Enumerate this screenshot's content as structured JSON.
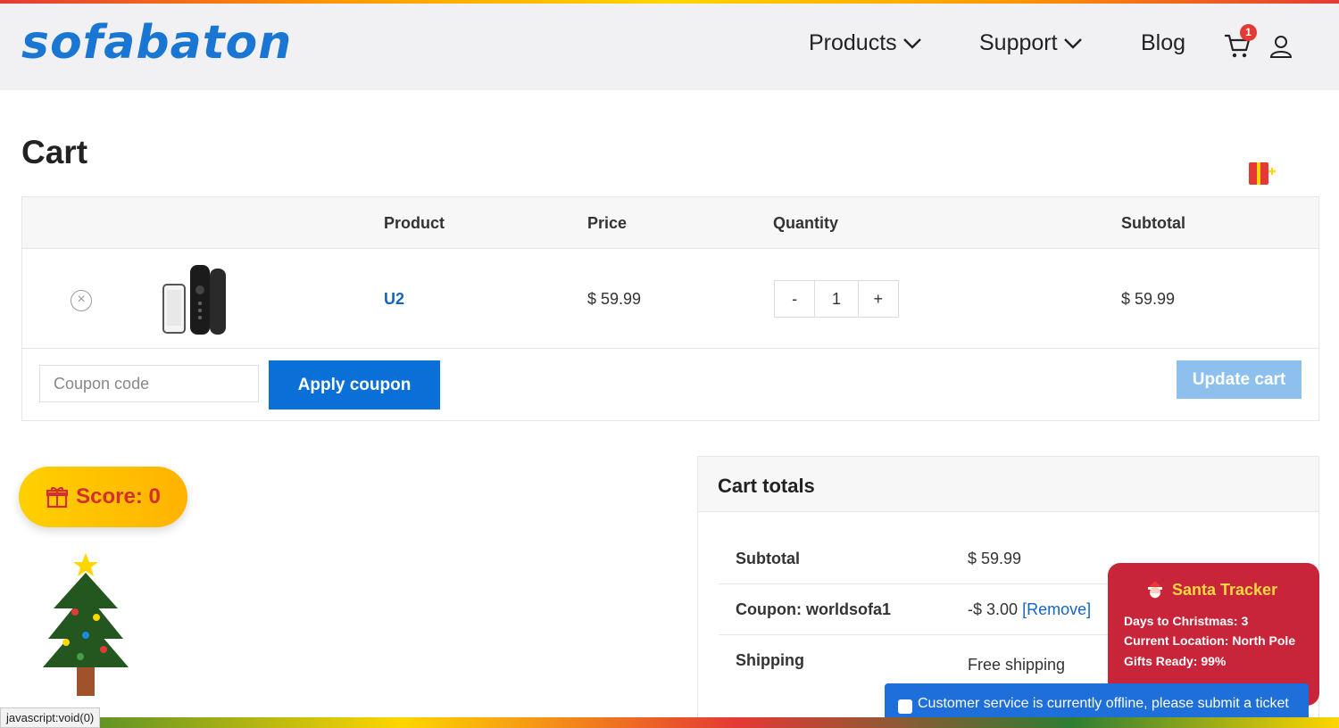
{
  "header": {
    "logo_text": "sofabaton",
    "nav": [
      {
        "label": "Products",
        "has_dropdown": true
      },
      {
        "label": "Support",
        "has_dropdown": true
      },
      {
        "label": "Blog",
        "has_dropdown": false
      }
    ],
    "cart_count": "1",
    "icons": [
      "cart-icon",
      "user-icon",
      "chevron-down-icon"
    ]
  },
  "page": {
    "title": "Cart"
  },
  "cart_table": {
    "headers": [
      "Product",
      "Price",
      "Quantity",
      "Subtotal"
    ],
    "items": [
      {
        "name": "U2",
        "price": "$ 59.99",
        "quantity": "1",
        "subtotal": "$ 59.99"
      }
    ],
    "qty_minus": "-",
    "qty_plus": "+",
    "remove_symbol": "×",
    "coupon_placeholder": "Coupon code",
    "apply_label": "Apply coupon",
    "update_label": "Update cart"
  },
  "score": {
    "label": "Score: 0"
  },
  "totals": {
    "title": "Cart totals",
    "rows": [
      {
        "label": "Subtotal",
        "value": "$ 59.99"
      },
      {
        "label": "Coupon: worldsofa1",
        "value": "-$ 3.00",
        "link": "[Remove]"
      },
      {
        "label": "Shipping",
        "value": "Free shipping"
      }
    ]
  },
  "santa_tracker": {
    "title": "Santa Tracker",
    "lines": [
      "Days to Christmas: 3",
      "Current Location: North Pole",
      "Gifts Ready: 99%"
    ]
  },
  "support_banner": {
    "text": "Customer service is currently offline, please submit a ticket"
  },
  "status_bar": {
    "url": "javascript:void(0)"
  },
  "colors": {
    "brand_blue": "#1976d2",
    "apply_button": "#0a6fd6",
    "update_button": "#8ec0ee",
    "santa_bg": "#c8253a",
    "badge_red": "#e53935",
    "score_yellow": "#ffc400"
  }
}
